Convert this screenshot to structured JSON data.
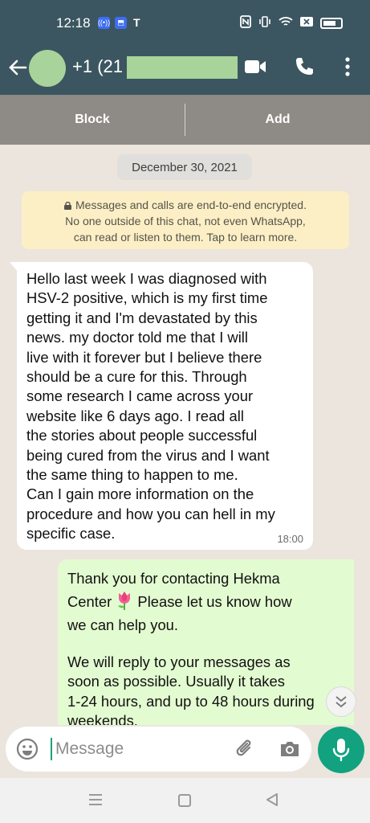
{
  "status_bar": {
    "time": "12:18",
    "carrier_mark": "T",
    "icons": [
      "radio-badge-icon",
      "app-badge-icon",
      "nfc-icon",
      "vibrate-icon",
      "wifi-icon",
      "box-icon",
      "battery-icon"
    ]
  },
  "header": {
    "contact_name": "+1 (21",
    "icons": [
      "back-arrow-icon",
      "video-call-icon",
      "voice-call-icon",
      "more-options-icon"
    ]
  },
  "contact_actions": {
    "block_label": "Block",
    "add_label": "Add"
  },
  "chat": {
    "date_chip": "December 30, 2021",
    "encryption_notice": {
      "line1": "Messages and calls are end-to-end encrypted.",
      "line2": "No one outside of this chat, not even WhatsApp,",
      "line3": "can read or listen to them. Tap to learn more."
    },
    "incoming_message": {
      "text": "Hello last week I was diagnosed with\nHSV-2 positive, which is my first time\ngetting it and I'm devastated by this\nnews. my doctor told me that I will\nlive with it forever but I believe there\nshould be a cure for this. Through\nsome research I came across your\nwebsite like 6 days ago. I read all\nthe stories about people successful\nbeing cured from the virus and I want\nthe same thing to happen to me.\nCan I gain more information on the\nprocedure and how you can hell in my\nspecific case.",
      "time": "18:00"
    },
    "outgoing_message": {
      "line1": "Thank you for contacting Hekma",
      "line2_start": "Center ",
      "line2_end": " Please let us know how",
      "line3": "we can help you.",
      "paragraph2": "We will reply to your messages as\nsoon as possible. Usually it takes\n1-24 hours, and up to 48 hours during\nweekends."
    }
  },
  "composer": {
    "placeholder": "Message"
  },
  "colors": {
    "header": "#3b5660",
    "action_bar": "#8e8a85",
    "chat_background": "#ece5dd",
    "outgoing_bubble": "#e3fbd1",
    "encryption_notice": "#fcefc5",
    "mic_button": "#12a27f"
  }
}
